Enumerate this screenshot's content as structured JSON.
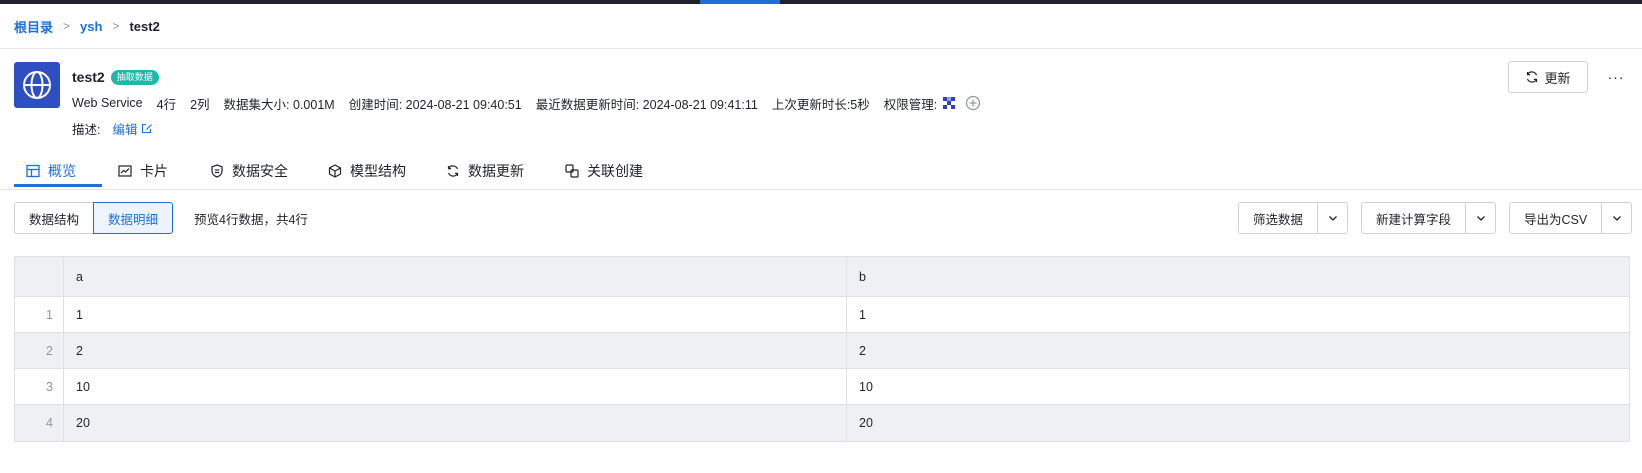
{
  "breadcrumb": {
    "root": "根目录",
    "folder": "ysh",
    "current": "test2"
  },
  "dataset": {
    "title": "test2",
    "badge": "抽取数据",
    "type": "Web Service",
    "rows": "4行",
    "cols": "2列",
    "size": "数据集大小: 0.001M",
    "created": "创建时间: 2024-08-21 09:40:51",
    "updated": "最近数据更新时间: 2024-08-21 09:41:11",
    "duration": "上次更新时长:5秒",
    "permission": "权限管理:",
    "desc_label": "描述:",
    "edit_label": "编辑"
  },
  "actions": {
    "refresh_label": "更新",
    "more_label": "···"
  },
  "tabs": [
    {
      "label": "概览",
      "icon": "table-icon"
    },
    {
      "label": "卡片",
      "icon": "chart-card-icon"
    },
    {
      "label": "数据安全",
      "icon": "shield-icon"
    },
    {
      "label": "模型结构",
      "icon": "cube-icon"
    },
    {
      "label": "数据更新",
      "icon": "refresh-icon"
    },
    {
      "label": "关联创建",
      "icon": "link-icon"
    }
  ],
  "view_toggle": {
    "structure": "数据结构",
    "detail": "数据明细"
  },
  "preview_text": "预览4行数据，共4行",
  "toolbar": {
    "filter": "筛选数据",
    "calc_field": "新建计算字段",
    "export": "导出为CSV"
  },
  "table": {
    "headers": [
      "a",
      "b"
    ],
    "rows": [
      {
        "idx": "1",
        "a": "1",
        "b": "1"
      },
      {
        "idx": "2",
        "a": "2",
        "b": "2"
      },
      {
        "idx": "3",
        "a": "10",
        "b": "10"
      },
      {
        "idx": "4",
        "a": "20",
        "b": "20"
      }
    ]
  },
  "colors": {
    "accent": "#1e6fd9",
    "icon_bg": "#2d4fc2",
    "badge": "#1fb8a8"
  }
}
